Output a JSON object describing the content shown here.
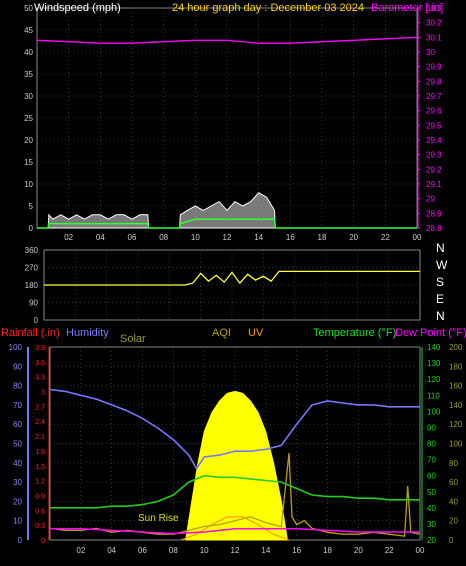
{
  "colors": {
    "wind": "#ffffff",
    "gust": "#33ff33",
    "barometer": "#ff00ff",
    "direction": "#ffff33",
    "rain": "#ff2222",
    "humidity": "#7777ff",
    "solar": "#ffff00",
    "solar_label": "#999933",
    "aqi": "#b8a000",
    "uv": "#ff9900",
    "temperature": "#22cc22",
    "dewpoint": "#ff00ff",
    "title": "#ffd000",
    "grid": "#666666"
  },
  "chart_data": [
    {
      "type": "line",
      "title": "24 hour graph day : December 03 2024",
      "ylabel": "Windspeed (mph)",
      "y2label": "Barometer [.in]",
      "x_ticks": [
        "02",
        "04",
        "06",
        "08",
        "10",
        "12",
        "14",
        "16",
        "18",
        "20",
        "22",
        "00"
      ],
      "ylim": [
        0,
        50
      ],
      "y_ticks": [
        0,
        5,
        10,
        15,
        20,
        25,
        30,
        35,
        40,
        45,
        50
      ],
      "y2lim": [
        28.8,
        30.3
      ],
      "y2_ticks": [
        "28.8",
        "28.9",
        "29",
        "29.1",
        "29.2",
        "29.3",
        "29.4",
        "29.5",
        "29.6",
        "29.7",
        "29.8",
        "29.9",
        "30",
        "30.1",
        "30.2",
        "30.3"
      ],
      "series": [
        {
          "key": "barometer",
          "axis": "y2",
          "x": [
            0,
            2,
            4,
            6,
            8,
            10,
            12,
            14,
            16,
            18,
            20,
            22,
            24
          ],
          "values": [
            30.08,
            30.07,
            30.06,
            30.06,
            30.07,
            30.08,
            30.08,
            30.06,
            30.06,
            30.07,
            30.08,
            30.09,
            30.1
          ]
        },
        {
          "key": "wind",
          "axis": "y",
          "x": [
            0,
            0.7,
            0.75,
            1,
            1.5,
            2,
            2.5,
            3,
            3.5,
            4,
            4.5,
            5,
            5.5,
            6,
            6.5,
            7,
            7.05,
            9,
            9.05,
            9.5,
            10,
            10.5,
            11,
            11.5,
            12,
            12.5,
            13,
            13.5,
            14,
            14.5,
            15,
            15.05,
            24
          ],
          "values": [
            0,
            0,
            3,
            2,
            3,
            2,
            3,
            2,
            3,
            3,
            2,
            3,
            3,
            2,
            3,
            3,
            0,
            0,
            3,
            4,
            5,
            4,
            5,
            6,
            4,
            6,
            5,
            6,
            8,
            7,
            4,
            0,
            0
          ]
        },
        {
          "key": "gust",
          "axis": "y",
          "x": [
            0,
            0.7,
            0.75,
            1,
            2,
            3,
            4,
            5,
            6,
            7,
            7.05,
            9,
            9.05,
            10,
            11,
            12,
            13,
            14,
            15,
            15.05,
            24
          ],
          "values": [
            0,
            0,
            1,
            1,
            1,
            1,
            1,
            1,
            1,
            1,
            0,
            0,
            1,
            2,
            2,
            2,
            2,
            2,
            2,
            0,
            0
          ]
        }
      ]
    },
    {
      "type": "line",
      "title": "",
      "ylim": [
        0,
        360
      ],
      "y_ticks": [
        0,
        90,
        180,
        270,
        360
      ],
      "compass": [
        "N",
        "W",
        "S",
        "E",
        "N"
      ],
      "x_ticks": [],
      "series": [
        {
          "key": "direction",
          "x": [
            0,
            9,
            9.5,
            10,
            10.5,
            11,
            11.5,
            12,
            12.5,
            13,
            13.5,
            14,
            14.5,
            15,
            16,
            18,
            20,
            22,
            24
          ],
          "values": [
            180,
            180,
            190,
            240,
            200,
            230,
            195,
            245,
            190,
            235,
            205,
            225,
            200,
            250,
            250,
            250,
            250,
            250,
            250
          ]
        }
      ]
    },
    {
      "type": "line",
      "title": "",
      "labels": [
        "Rainfall (.in)",
        "Humidity",
        "Solar",
        "AQI",
        "UV",
        "Temperature (°F)",
        "Dew Point (°F)"
      ],
      "annotation": "Sun Rise",
      "x_ticks": [
        "02",
        "04",
        "06",
        "08",
        "10",
        "12",
        "14",
        "16",
        "18",
        "20",
        "22",
        "00"
      ],
      "y_humidity": [
        0,
        10,
        20,
        30,
        40,
        50,
        60,
        70,
        80,
        90,
        100
      ],
      "y_rain": [
        "0",
        "0.3",
        "0.6",
        "0.9",
        "1.2",
        "1.5",
        "1.8",
        "2.1",
        "2.4",
        "2.7",
        "3",
        "3.3",
        "3.6",
        "3.9"
      ],
      "y_temp": [
        20,
        30,
        40,
        50,
        60,
        70,
        80,
        90,
        100,
        110,
        120,
        130,
        140
      ],
      "y_solar": [
        0,
        20,
        40,
        60,
        80,
        100,
        120,
        140,
        160,
        180,
        200
      ],
      "ylim": [
        0,
        100
      ],
      "series": [
        {
          "key": "humidity",
          "x": [
            0,
            1,
            2,
            3,
            4,
            5,
            6,
            7,
            8,
            9,
            9.5,
            10,
            11,
            12,
            13,
            14,
            15,
            16,
            17,
            18,
            19,
            20,
            21,
            22,
            23,
            24
          ],
          "values": [
            78,
            77,
            75,
            73,
            70,
            67,
            63,
            58,
            52,
            44,
            37,
            43,
            44,
            46,
            46,
            47,
            49,
            60,
            70,
            72,
            71,
            70,
            70,
            69,
            69,
            69
          ]
        },
        {
          "key": "temperature",
          "x": [
            0,
            1,
            2,
            3,
            4,
            5,
            6,
            7,
            8,
            9,
            10,
            11,
            12,
            13,
            14,
            15,
            16,
            17,
            18,
            19,
            20,
            21,
            22,
            23,
            24
          ],
          "values": [
            40,
            40,
            40,
            40,
            41,
            41,
            42,
            44,
            48,
            56,
            60,
            59,
            59,
            58,
            57,
            56,
            52,
            48,
            47,
            47,
            46,
            46,
            45,
            45,
            45
          ]
        },
        {
          "key": "dewpoint",
          "x": [
            0,
            2,
            4,
            6,
            8,
            10,
            12,
            14,
            16,
            18,
            20,
            22,
            24
          ],
          "values": [
            27,
            27,
            26,
            25,
            24,
            25,
            27,
            27,
            27,
            26,
            25,
            25,
            25
          ]
        },
        {
          "key": "solar",
          "x": [
            8.8,
            9.2,
            9.6,
            10,
            10.5,
            11,
            11.5,
            12,
            12.5,
            13,
            13.5,
            14,
            14.5,
            15,
            15.4
          ],
          "values": [
            0,
            20,
            40,
            56,
            66,
            72,
            76,
            77,
            76,
            72,
            66,
            56,
            40,
            20,
            0
          ]
        },
        {
          "key": "uv",
          "x": [
            8.5,
            9.5,
            10.5,
            11.5,
            12.5,
            13.5,
            14.5,
            15.5
          ],
          "values": [
            0,
            3,
            8,
            12,
            12,
            8,
            3,
            0
          ]
        },
        {
          "key": "aqi",
          "x": [
            0,
            1,
            2,
            3,
            4,
            5,
            6,
            7,
            8,
            9,
            10,
            11,
            12,
            13,
            14,
            15,
            15.5,
            15.7,
            16,
            16.5,
            17,
            18,
            19,
            20,
            21,
            22,
            23,
            23.2,
            23.4,
            24
          ],
          "values": [
            6,
            5,
            5,
            6,
            4,
            5,
            4,
            3,
            3,
            5,
            7,
            8,
            10,
            12,
            9,
            7,
            45,
            12,
            8,
            10,
            6,
            4,
            3,
            3,
            4,
            3,
            2,
            28,
            4,
            3
          ]
        }
      ]
    }
  ]
}
